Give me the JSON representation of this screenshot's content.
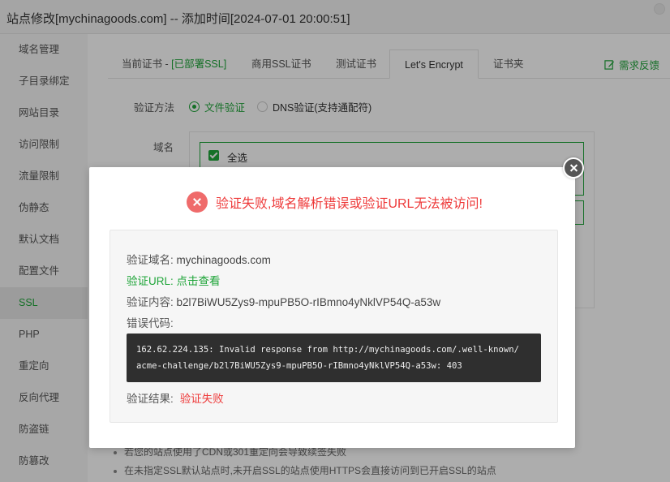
{
  "window": {
    "title": "站点修改[mychinagoods.com] -- 添加时间[2024-07-01 20:00:51]"
  },
  "sidebar": {
    "items": [
      {
        "label": "域名管理"
      },
      {
        "label": "子目录绑定"
      },
      {
        "label": "网站目录"
      },
      {
        "label": "访问限制"
      },
      {
        "label": "流量限制"
      },
      {
        "label": "伪静态"
      },
      {
        "label": "默认文档"
      },
      {
        "label": "配置文件"
      },
      {
        "label": "SSL"
      },
      {
        "label": "PHP"
      },
      {
        "label": "重定向"
      },
      {
        "label": "反向代理"
      },
      {
        "label": "防盗链"
      },
      {
        "label": "防篡改"
      }
    ],
    "active": "SSL"
  },
  "tabs": {
    "current_cert_prefix": "当前证书 - ",
    "current_cert_status": "[已部署SSL]",
    "commercial": "商用SSL证书",
    "test": "测试证书",
    "letsencrypt": "Let's Encrypt",
    "cert_folder": "证书夹",
    "active": "Let's Encrypt"
  },
  "feedback": {
    "label": "需求反馈"
  },
  "form": {
    "verify_method_label": "验证方法",
    "file_verify": "文件验证",
    "dns_verify": "DNS验证(支持通配符)",
    "domain_label": "域名",
    "select_all": "全选"
  },
  "notes": [
    "若您的站点使用了CDN或301重定向会导致续签失败",
    "在未指定SSL默认站点时,未开启SSL的站点使用HTTPS会直接访问到已开启SSL的站点"
  ],
  "dialog": {
    "error_title": "验证失败,域名解析错误或验证URL无法被访问!",
    "domain_label": "验证域名:",
    "domain_value": "mychinagoods.com",
    "url_label": "验证URL:",
    "url_link": "点击查看",
    "content_label": "验证内容:",
    "content_value": "b2l7BiWU5Zys9-mpuPB5O-rIBmno4yNklVP54Q-a53w",
    "code_label": "错误代码:",
    "code_line1": "162.62.224.135: Invalid response from http://mychinagoods.com/.well-known/",
    "code_line2": "acme-challenge/b2l7BiWU5Zys9-mpuPB5O-rIBmno4yNklVP54Q-a53w: 403",
    "result_label": "验证结果:",
    "result_value": "验证失败"
  },
  "colors": {
    "accent": "#20a53a",
    "error": "#ee3b3b",
    "error_icon": "#ef6b6b",
    "code_bg": "#2f2f2f"
  },
  "icons": {
    "feedback": "edit-icon",
    "error": "error-circle-icon",
    "close": "close-icon"
  }
}
